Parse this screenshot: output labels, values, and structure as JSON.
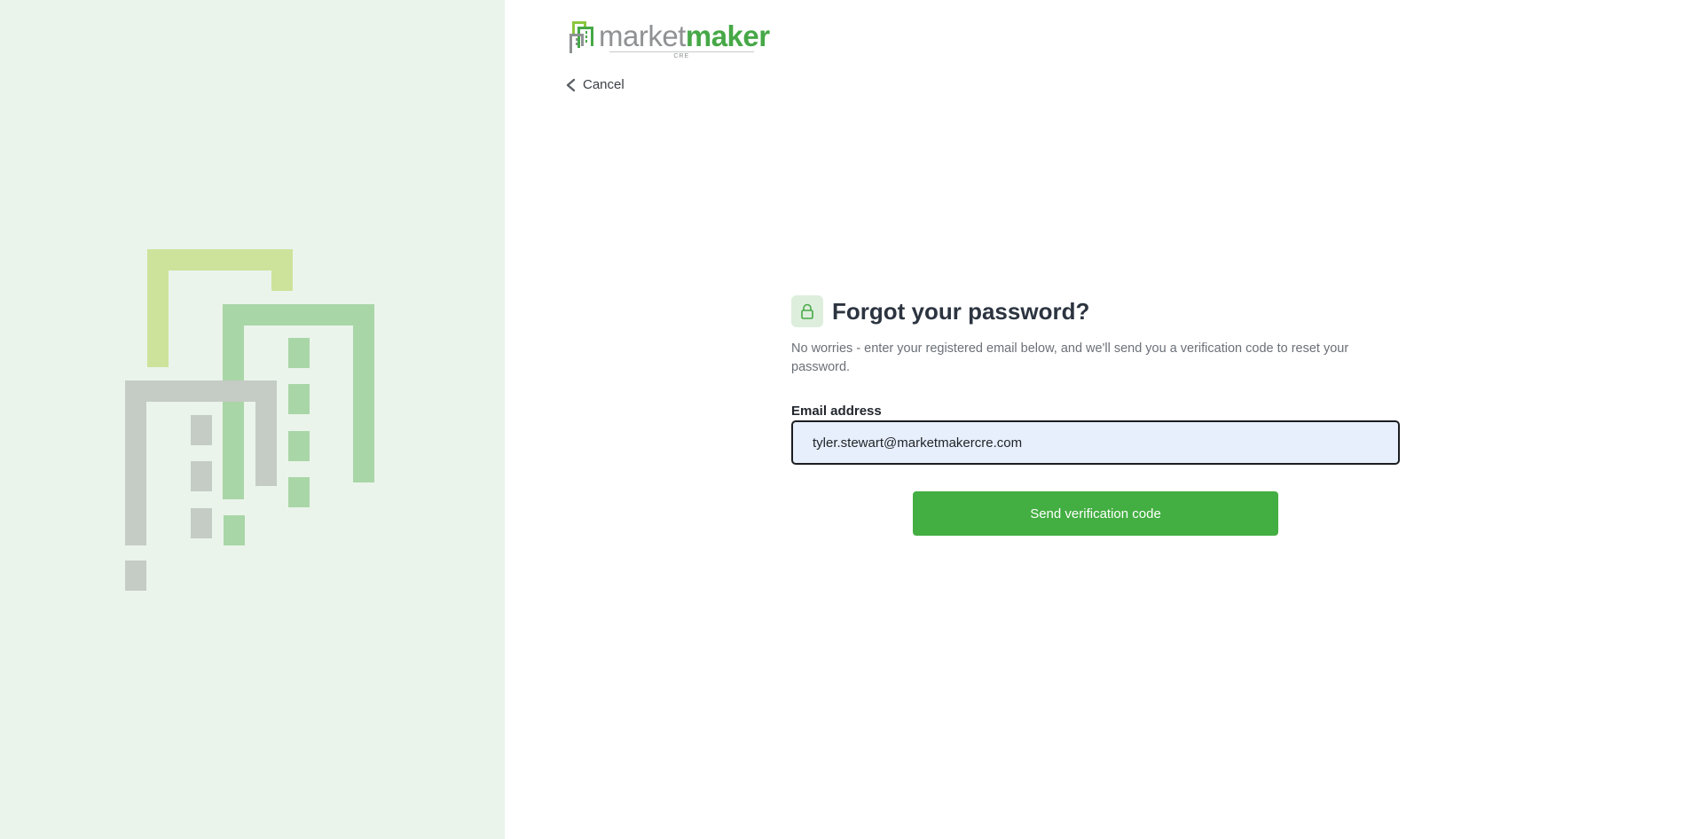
{
  "brand": {
    "word_light": "market",
    "word_bold": "maker",
    "sub": "CRE",
    "green": "#46a847",
    "gray": "#8f9193"
  },
  "nav": {
    "cancel_label": "Cancel",
    "cancel_icon": "chevron-left-icon"
  },
  "form": {
    "icon": "lock-icon",
    "title": "Forgot your password?",
    "description": "No worries - enter your registered email below, and we'll send you a verification code to reset your password.",
    "email_label": "Email address",
    "email_value": "tyler.stewart@marketmakercre.com",
    "submit_label": "Send verification code"
  },
  "colors": {
    "side_bg": "#eaf4eb",
    "button": "#43ae42",
    "input_bg": "#e8effc",
    "title": "#2c3440"
  }
}
